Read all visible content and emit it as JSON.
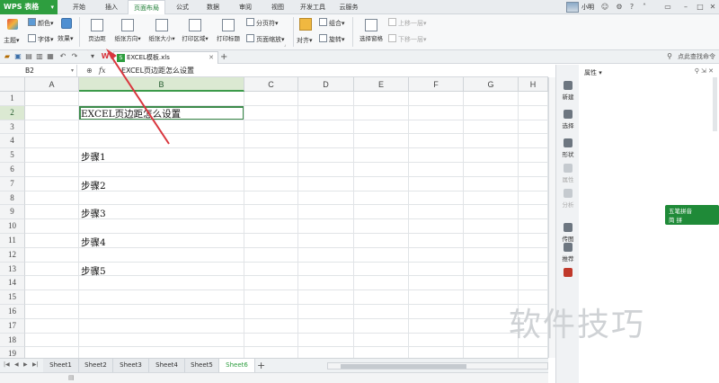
{
  "app": {
    "title": "WPS 表格",
    "caret": "▾"
  },
  "menu": {
    "tabs": [
      {
        "label": "开始"
      },
      {
        "label": "插入"
      },
      {
        "label": "页面布局",
        "active": true
      },
      {
        "label": "公式"
      },
      {
        "label": "数据"
      },
      {
        "label": "审阅"
      },
      {
        "label": "视图"
      },
      {
        "label": "开发工具"
      },
      {
        "label": "云服务"
      }
    ]
  },
  "user": {
    "name": "小明",
    "status_icon": "user-status-icon"
  },
  "ribbon": {
    "theme": "主题",
    "colors": "颜色",
    "fonts": "字体",
    "effects": "效果",
    "margins": "页边距",
    "orientation": "纸张方向",
    "size": "纸张大小",
    "print_area": "打印区域",
    "print_titles": "打印标题",
    "page_break": "分页符",
    "page_scale": "页面缩放",
    "group": "组合",
    "align": "对齐",
    "rotate": "旋转",
    "selection_pane": "选择窗格",
    "bring_forward": "上移一层",
    "send_backward": "下移一层"
  },
  "doc": {
    "tab_name": "EXCEL模板.xls",
    "find_command": "点此查找命令"
  },
  "formula_bar": {
    "cell_ref": "B2",
    "fx": "fx",
    "content": "EXCEL页边距怎么设置"
  },
  "grid": {
    "columns": [
      "A",
      "B",
      "C",
      "D",
      "E",
      "F",
      "G",
      "H"
    ],
    "selected_column": "B",
    "rows": [
      "1",
      "2",
      "3",
      "4",
      "5",
      "6",
      "7",
      "8",
      "9",
      "10",
      "11",
      "12",
      "13",
      "14",
      "15",
      "16",
      "17",
      "18",
      "19"
    ],
    "selected_row": "2",
    "cells": [
      {
        "row": 2,
        "text": "EXCEL页边距怎么设置"
      },
      {
        "row": 5,
        "text": "步骤1"
      },
      {
        "row": 7,
        "text": "步骤2"
      },
      {
        "row": 9,
        "text": "步骤3"
      },
      {
        "row": 11,
        "text": "步骤4"
      },
      {
        "row": 13,
        "text": "步骤5"
      }
    ]
  },
  "sheets": {
    "tabs": [
      "Sheet1",
      "Sheet2",
      "Sheet3",
      "Sheet4",
      "Sheet5",
      "Sheet6"
    ],
    "active": "Sheet6",
    "add": "+"
  },
  "side_tools": [
    {
      "label": "新建",
      "dim": false
    },
    {
      "label": "选择",
      "dim": false
    },
    {
      "label": "形状",
      "dim": false
    },
    {
      "label": "属性",
      "dim": true
    },
    {
      "label": "分析",
      "dim": true
    },
    {
      "label": "传图",
      "dim": false
    },
    {
      "label": "推荐",
      "dim": false
    }
  ],
  "properties_panel": {
    "title": "属性"
  },
  "ime": {
    "line1": "五笔拼音",
    "line2": "简 拼"
  },
  "watermark": "软件技巧",
  "colors": {
    "accent": "#2e9e3f",
    "selection": "#3c8a4a",
    "arrow": "#d9363e"
  }
}
